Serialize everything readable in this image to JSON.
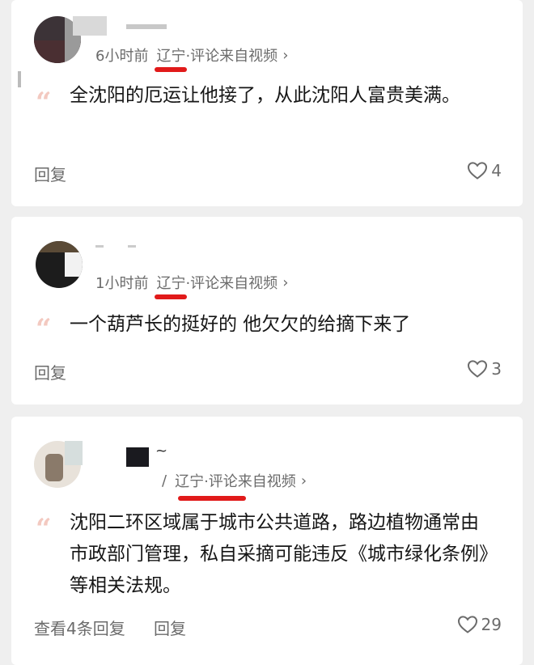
{
  "comments": [
    {
      "time": "6小时前",
      "location": "辽宁",
      "source": "·评论来自视频",
      "text": "全沈阳的厄运让他接了，从此沈阳人富贵美满。",
      "actions": {
        "reply": "回复"
      },
      "likes": "4"
    },
    {
      "time": "1小时前",
      "location": "辽宁",
      "source": "·评论来自视频",
      "text": "一个葫芦长的挺好的 他欠欠的给摘下来了",
      "actions": {
        "reply": "回复"
      },
      "likes": "3"
    },
    {
      "time": "/",
      "location": "辽宁",
      "source": "·评论来自视频",
      "username_tail": "~",
      "text": "沈阳二环区域属于城市公共道路，路边植物通常由市政部门管理，私自采摘可能违反《城市绿化条例》等相关法规。",
      "actions": {
        "view_replies": "查看4条回复",
        "reply": "回复"
      },
      "likes": "29"
    }
  ],
  "icons": {
    "chevron": "chevron-right-icon",
    "like": "heart-outline-icon",
    "quote": "quote-mark-icon"
  },
  "colors": {
    "highlight": "#e11a1a",
    "quote": "#f3c9c0"
  }
}
